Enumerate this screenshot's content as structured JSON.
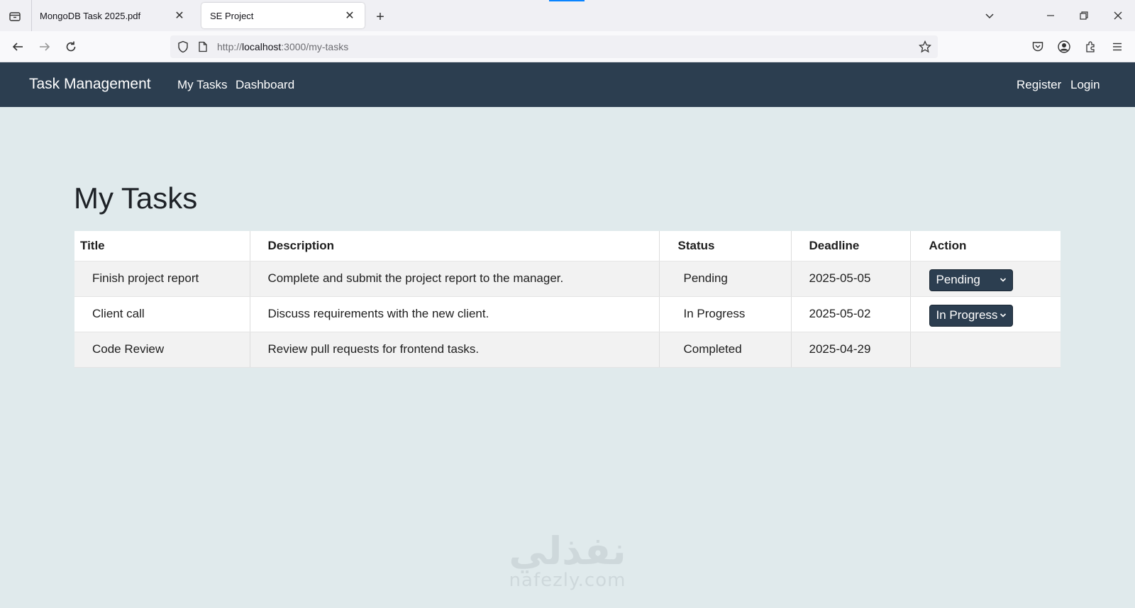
{
  "browser": {
    "tabs": [
      {
        "title": "MongoDB Task 2025.pdf",
        "active": false
      },
      {
        "title": "SE Project",
        "active": true
      }
    ],
    "url": {
      "scheme": "http://",
      "host": "localhost",
      "rest": ":3000/my-tasks"
    },
    "icons": [
      "tab-list-icon",
      "close-icon",
      "new-tab-icon",
      "list-all-tabs-icon",
      "minimize-icon",
      "restore-icon",
      "close-window-icon",
      "back-icon",
      "forward-icon",
      "reload-icon",
      "shield-icon",
      "page-icon",
      "bookmark-star-icon",
      "pocket-icon",
      "account-icon",
      "extensions-icon",
      "menu-icon"
    ]
  },
  "app": {
    "brand": "Task Management",
    "nav_left": [
      "My Tasks",
      "Dashboard"
    ],
    "nav_right": [
      "Register",
      "Login"
    ]
  },
  "page": {
    "title": "My Tasks",
    "table": {
      "headers": [
        "Title",
        "Description",
        "Status",
        "Deadline",
        "Action"
      ],
      "rows": [
        {
          "title": "Finish project report",
          "description": "Complete and submit the project report to the manager.",
          "status": "Pending",
          "deadline": "2025-05-05",
          "action": "Pending"
        },
        {
          "title": "Client call",
          "description": "Discuss requirements with the new client.",
          "status": "In Progress",
          "deadline": "2025-05-02",
          "action": "In Progress"
        },
        {
          "title": "Code Review",
          "description": "Review pull requests for frontend tasks.",
          "status": "Completed",
          "deadline": "2025-04-29",
          "action": ""
        }
      ]
    }
  },
  "watermark": {
    "arabic": "نفذلي",
    "latin": "nafezly.com"
  },
  "colors": {
    "navbar": "#2c3e50",
    "page_background": "#e0eaec",
    "select_background": "#2c3e50"
  }
}
